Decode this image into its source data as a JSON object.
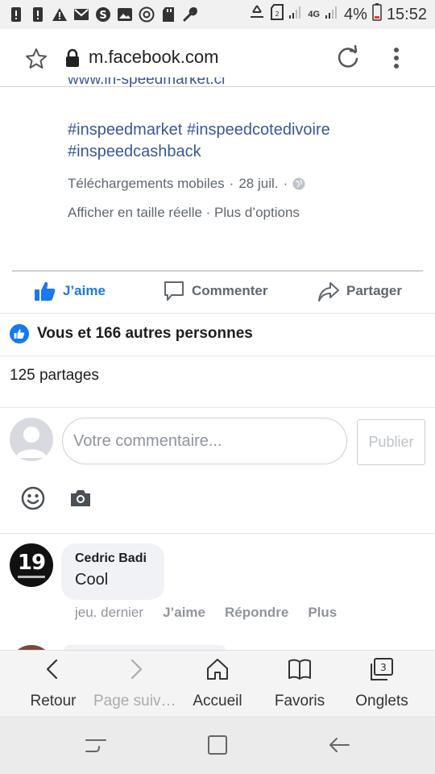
{
  "status_bar": {
    "battery": "4%",
    "time": "15:52",
    "network": "4G"
  },
  "url_bar": {
    "url": "m.facebook.com"
  },
  "post": {
    "link_partial": "www.in-speedmarket.ci",
    "hashtags": "#inspeedmarket #inspeedcotedivoire #inspeedcashback",
    "source": "Téléchargements mobiles",
    "date": "28 juil.",
    "separator": "·",
    "view_full": "Afficher en taille réelle · Plus d’options"
  },
  "actions": {
    "like": "J’aime",
    "comment": "Commenter",
    "share": "Partager"
  },
  "reactions": {
    "summary": "Vous et 166 autres personnes",
    "shares": "125 partages"
  },
  "composer": {
    "placeholder": "Votre commentaire...",
    "publish": "Publier"
  },
  "comments": [
    {
      "author": "Cedric Badi",
      "text": "Cool",
      "avatar_text": "19",
      "time": "jeu. dernier",
      "like": "J’aime",
      "reply": "Répondre",
      "more": "Plus"
    }
  ],
  "bottom_bar": {
    "back": "Retour",
    "forward": "Page suiva…",
    "home": "Accueil",
    "bookmarks": "Favoris",
    "tabs": "Onglets",
    "tab_count": "3"
  },
  "colors": {
    "accent": "#1877f2",
    "link": "#385898",
    "meta": "#606770"
  }
}
